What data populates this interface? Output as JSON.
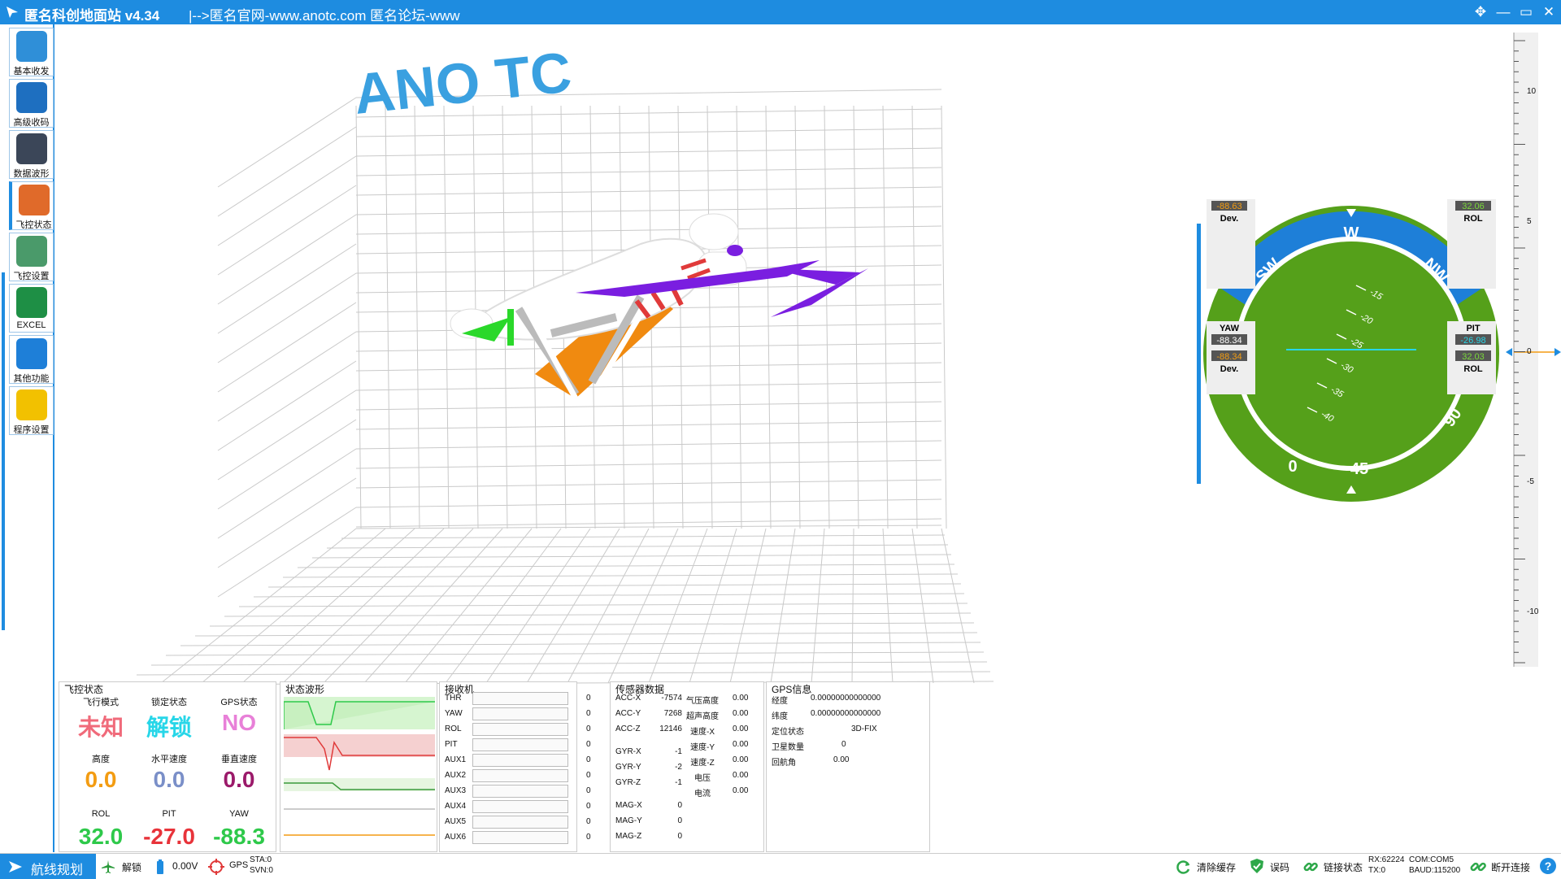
{
  "window": {
    "title": "匿名科创地面站 v4.34",
    "link_text": "|-->匿名官网-www.anotc.com   匿名论坛-www",
    "move_icon": "move-icon",
    "min_icon": "minimize-icon",
    "max_icon": "maximize-icon",
    "close_icon": "close-icon"
  },
  "sidebar": {
    "items": [
      {
        "label": "基本收发",
        "icon": "terminal-icon",
        "color": "#2f8fd8"
      },
      {
        "label": "高级收码",
        "icon": "lines-icon",
        "color": "#1e6fc0"
      },
      {
        "label": "数据波形",
        "icon": "bar-chart-icon",
        "color": "#3b4658"
      },
      {
        "label": "飞控状态",
        "icon": "gauge-icon",
        "color": "#e06a2a"
      },
      {
        "label": "飞控设置",
        "icon": "sliders-icon",
        "color": "#4a9a6a"
      },
      {
        "label": "EXCEL",
        "icon": "spreadsheet-icon",
        "color": "#1e8f45"
      },
      {
        "label": "其他功能",
        "icon": "dropbox-icon",
        "color": "#1e7fd8"
      },
      {
        "label": "程序设置",
        "icon": "gear-icon",
        "color": "#f2c100"
      }
    ]
  },
  "scene": {
    "logo": "ANO TC"
  },
  "gauge": {
    "compass": [
      "SW",
      "W",
      "NW"
    ],
    "ring": [
      "0",
      "45",
      "90"
    ],
    "pitch_ticks": [
      "-15",
      "-20",
      "-25",
      "-30",
      "-35",
      "-40"
    ],
    "left_top": {
      "value": "-88.63",
      "label": "Dev."
    },
    "yaw": {
      "label": "YAW",
      "value": "-88.34",
      "dev_value": "-88.34",
      "dev_label": "Dev."
    },
    "right_top": {
      "value": "32.06",
      "label": "ROL"
    },
    "pit": {
      "label": "PIT",
      "value": "-26.98",
      "rol_value": "32.03",
      "rol_label": "ROL"
    }
  },
  "scale": {
    "ticks": [
      "10",
      "5",
      "0",
      "-5",
      "-10"
    ]
  },
  "panels": {
    "flight": {
      "title": "飞控状态",
      "labels": [
        "飞行模式",
        "锁定状态",
        "GPS状态",
        "高度",
        "水平速度",
        "垂直速度",
        "ROL",
        "PIT",
        "YAW"
      ],
      "values": [
        "未知",
        "解锁",
        "NO",
        "0.0",
        "0.0",
        "0.0",
        "32.0",
        "-27.0",
        "-88.3"
      ],
      "colors": [
        "#f06a7a",
        "#27d6e8",
        "#e880d8",
        "#f39c12",
        "#7a8fc8",
        "#9b1a6a",
        "#2ec94a",
        "#e8333a",
        "#2ec94a"
      ]
    },
    "wave": {
      "title": "状态波形"
    },
    "receiver": {
      "title": "接收机",
      "channels": [
        {
          "name": "THR",
          "value": "0"
        },
        {
          "name": "YAW",
          "value": "0"
        },
        {
          "name": "ROL",
          "value": "0"
        },
        {
          "name": "PIT",
          "value": "0"
        },
        {
          "name": "AUX1",
          "value": "0"
        },
        {
          "name": "AUX2",
          "value": "0"
        },
        {
          "name": "AUX3",
          "value": "0"
        },
        {
          "name": "AUX4",
          "value": "0"
        },
        {
          "name": "AUX5",
          "value": "0"
        },
        {
          "name": "AUX6",
          "value": "0"
        }
      ]
    },
    "sensor": {
      "title": "传感器数据",
      "left": [
        {
          "k": "ACC-X",
          "v": "-7574"
        },
        {
          "k": "ACC-Y",
          "v": "7268"
        },
        {
          "k": "ACC-Z",
          "v": "12146"
        },
        {
          "k": "GYR-X",
          "v": "-1"
        },
        {
          "k": "GYR-Y",
          "v": "-2"
        },
        {
          "k": "GYR-Z",
          "v": "-1"
        },
        {
          "k": "MAG-X",
          "v": "0"
        },
        {
          "k": "MAG-Y",
          "v": "0"
        },
        {
          "k": "MAG-Z",
          "v": "0"
        }
      ],
      "right": [
        {
          "k": "气压高度",
          "v": "0.00"
        },
        {
          "k": "超声高度",
          "v": "0.00"
        },
        {
          "k": "速度-X",
          "v": "0.00"
        },
        {
          "k": "速度-Y",
          "v": "0.00"
        },
        {
          "k": "速度-Z",
          "v": "0.00"
        },
        {
          "k": "电压",
          "v": "0.00"
        },
        {
          "k": "电流",
          "v": "0.00"
        }
      ]
    },
    "gps": {
      "title": "GPS信息",
      "rows": [
        {
          "k": "经度",
          "v": "0.00000000000000"
        },
        {
          "k": "纬度",
          "v": "0.00000000000000"
        },
        {
          "k": "定位状态",
          "v": "3D-FIX"
        },
        {
          "k": "卫星数量",
          "v": "0"
        },
        {
          "k": "回航角",
          "v": "0.00"
        }
      ]
    }
  },
  "statusbar": {
    "route": "航线规划",
    "unlock": "解锁",
    "voltage": "0.00V",
    "gps": "GPS",
    "sta": "STA:0",
    "svn": "SVN:0",
    "clear": "清除缓存",
    "error": "误码",
    "link": "链接状态",
    "rx": "RX:62224",
    "tx": "TX:0",
    "com": "COM:COM5",
    "baud": "BAUD:115200",
    "disconnect": "断开连接",
    "help": "?"
  }
}
